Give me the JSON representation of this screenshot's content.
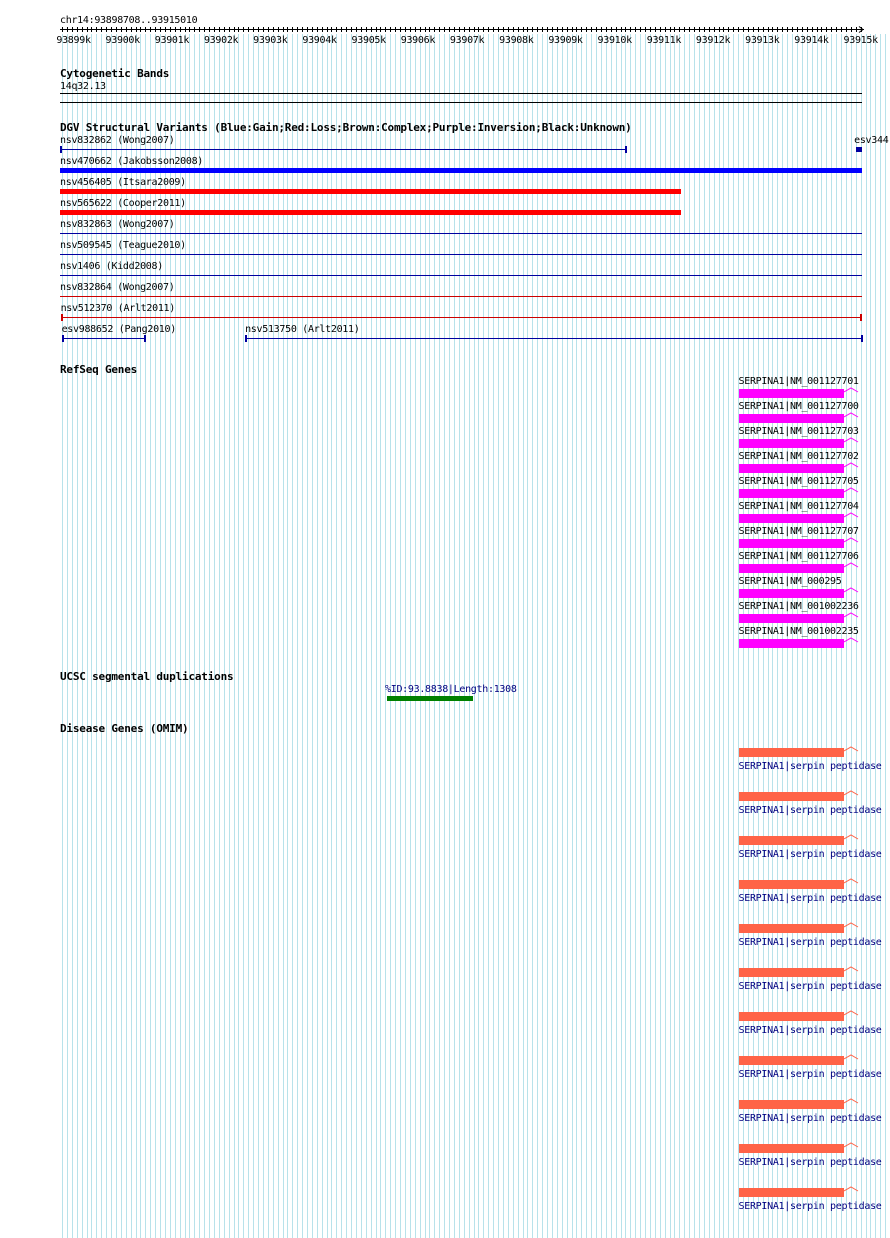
{
  "region": "chr14:93898708..93915010",
  "ticks": [
    "93899k",
    "93900k",
    "93901k",
    "93902k",
    "93903k",
    "93904k",
    "93905k",
    "93906k",
    "93907k",
    "93908k",
    "93909k",
    "93910k",
    "93911k",
    "93912k",
    "93913k",
    "93914k",
    "93915k"
  ],
  "cytoband": {
    "title": "Cytogenetic Bands",
    "label": "14q32.13"
  },
  "dgv": {
    "title": "DGV Structural Variants (Blue:Gain;Red:Loss;Brown:Complex;Purple:Inversion;Black:Unknown)",
    "colors": {
      "gain": "#0000ff",
      "loss": "#ff0000",
      "thin_gain": "#0000a0",
      "thin_loss": "#cc0000"
    },
    "variants": [
      {
        "label": "nsv832862 (Wong2007)",
        "type": "gain",
        "start": 93898708,
        "end": 93910220
      },
      {
        "label": "esv344",
        "type": "gain",
        "start": 93914890,
        "end": 93915010
      },
      {
        "label": "nsv470662 (Jakobsson2008)",
        "type": "gain",
        "start": 93898708,
        "end": 93915010
      },
      {
        "label": "nsv456405 (Itsara2009)",
        "type": "loss",
        "start": 93898708,
        "end": 93911330
      },
      {
        "label": "nsv565622 (Cooper2011)",
        "type": "loss",
        "start": 93898708,
        "end": 93911330
      },
      {
        "label": "nsv832863 (Wong2007)",
        "type": "gain",
        "start": 93898708,
        "end": 93915010
      },
      {
        "label": "nsv509545 (Teague2010)",
        "type": "gain",
        "start": 93898708,
        "end": 93915010
      },
      {
        "label": "nsv1406 (Kidd2008)",
        "type": "gain",
        "start": 93898708,
        "end": 93915010
      },
      {
        "label": "nsv832864 (Wong2007)",
        "type": "loss",
        "start": 93898708,
        "end": 93915010
      },
      {
        "label": "nsv512370 (Arlt2011)",
        "type": "loss",
        "start": 93898720,
        "end": 93914990
      },
      {
        "label": "esv988652 (Pang2010)",
        "type": "gain",
        "start": 93898740,
        "end": 93900430
      },
      {
        "label": "nsv513750 (Arlt2011)",
        "type": "gain",
        "start": 93902470,
        "end": 93915010
      }
    ]
  },
  "refseq": {
    "title": "RefSeq Genes",
    "color": "#ff00ff",
    "gene_start": 93912500,
    "gene_end": 93914940,
    "transcripts": [
      "SERPINA1|NM_001127701",
      "SERPINA1|NM_001127700",
      "SERPINA1|NM_001127703",
      "SERPINA1|NM_001127702",
      "SERPINA1|NM_001127705",
      "SERPINA1|NM_001127704",
      "SERPINA1|NM_001127707",
      "SERPINA1|NM_001127706",
      "SERPINA1|NM_000295",
      "SERPINA1|NM_001002236",
      "SERPINA1|NM_001002235"
    ]
  },
  "segdup": {
    "title": "UCSC segmental duplications",
    "label": "%ID:93.8838|Length:1308",
    "color": "#008000",
    "start": 93905350,
    "end": 93907110
  },
  "omim": {
    "title": "Disease Genes (OMIM)",
    "color": "#ff6347",
    "gene_start": 93912500,
    "gene_end": 93914940,
    "entries": [
      "SERPINA1|serpin peptidase",
      "SERPINA1|serpin peptidase",
      "SERPINA1|serpin peptidase",
      "SERPINA1|serpin peptidase",
      "SERPINA1|serpin peptidase",
      "SERPINA1|serpin peptidase",
      "SERPINA1|serpin peptidase",
      "SERPINA1|serpin peptidase",
      "SERPINA1|serpin peptidase",
      "SERPINA1|serpin peptidase",
      "SERPINA1|serpin peptidase"
    ]
  }
}
